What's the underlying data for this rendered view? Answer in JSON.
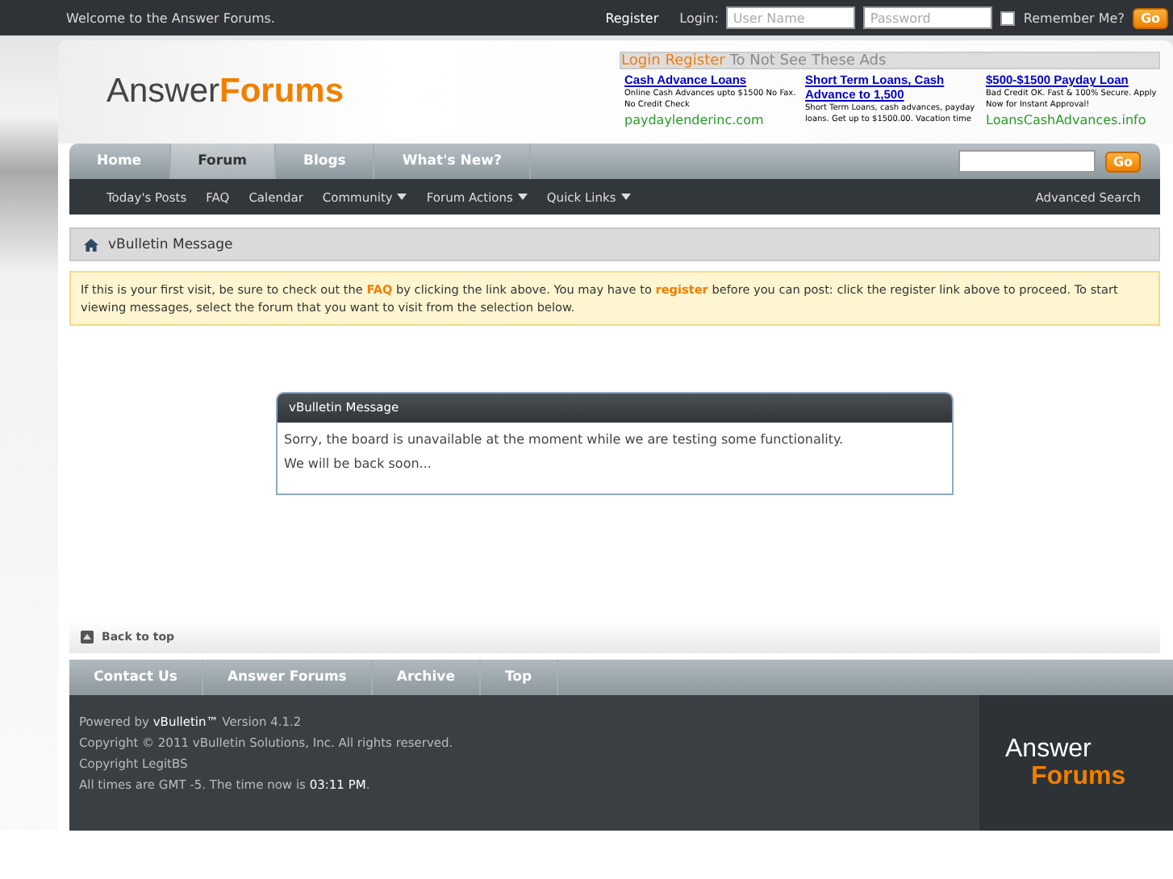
{
  "top_bar": {
    "welcome": "Welcome to the Answer Forums.",
    "register": "Register",
    "login_label": "Login:",
    "username_placeholder": "User Name",
    "password_placeholder": "Password",
    "remember": {
      "label": "Remember Me?",
      "checked": false
    },
    "go": "Go"
  },
  "logo": {
    "part_1": "Answer",
    "part_2": "Forums"
  },
  "ads": {
    "header_links": [
      "Login",
      "Register"
    ],
    "header_text": "To Not See These Ads",
    "items": [
      {
        "title": "Cash Advance Loans",
        "description": "Online Cash Advances upto $1500 No Fax. No Credit Check",
        "url": "paydaylenderinc.com"
      },
      {
        "title": "Short Term Loans, Cash Advance to 1,500",
        "description": "Short Term Loans, cash advances, payday loans. Get up to $1500.00. Vacation time"
      },
      {
        "title": "$500-$1500 Payday Loan",
        "description": "Bad Credit OK. Fast & 100% Secure. Apply Now for Instant Approval!",
        "url": "LoansCashAdvances.info"
      }
    ]
  },
  "nav_tabs": [
    {
      "label": "Home",
      "selected": false
    },
    {
      "label": "Forum",
      "selected": true
    },
    {
      "label": "Blogs",
      "selected": false
    },
    {
      "label": "What's New?",
      "selected": false
    }
  ],
  "search_go": "Go",
  "sub_nav": [
    {
      "label": "Today's Posts",
      "dropdown": false
    },
    {
      "label": "FAQ",
      "dropdown": false
    },
    {
      "label": "Calendar",
      "dropdown": false
    },
    {
      "label": "Community",
      "dropdown": true
    },
    {
      "label": "Forum Actions",
      "dropdown": true
    },
    {
      "label": "Quick Links",
      "dropdown": true
    }
  ],
  "advanced_search": "Advanced Search",
  "breadcrumb": "vBulletin Message",
  "notice": "If this is your first visit, be sure to check out the **FAQ** by clicking the link above. You may have to **register** before you can post: click the register link above to proceed. To start viewing messages, select the forum that you want to visit from the selection below.",
  "message": {
    "title": "vBulletin Message",
    "lines": [
      "Sorry, the board is unavailable at the moment while we are testing some functionality.",
      "We will be back soon..."
    ]
  },
  "back_to_top": "Back to top",
  "footer_links": [
    "Contact Us",
    "Answer Forums",
    "Archive",
    "Top"
  ],
  "footer_lines": [
    "Powered by **vBulletin™** Version 4.1.2",
    "Copyright © 2011 vBulletin Solutions, Inc. All rights reserved.",
    "Copyright LegitBS",
    "All times are GMT -5. The time now is **03:11 PM**."
  ],
  "footer_logo": {
    "part_1": "Answer",
    "part_2": "Forums"
  }
}
